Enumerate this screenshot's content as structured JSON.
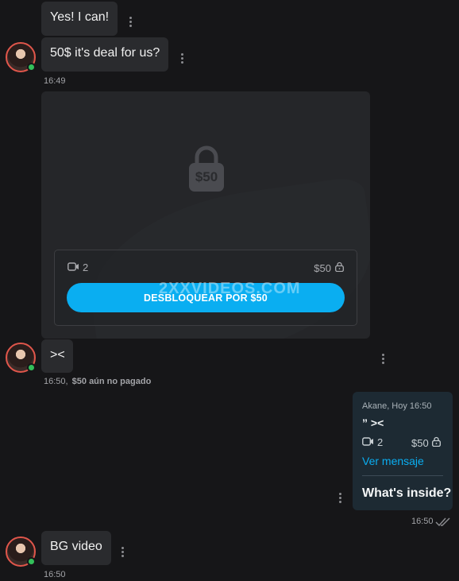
{
  "messages": {
    "m1": {
      "text": "Yes! I can!"
    },
    "m2": {
      "text": "50$ it's deal for us?",
      "time": "16:49"
    },
    "locked_post": {
      "lock_price": "$50",
      "video_count": "2",
      "price": "$50",
      "unlock_label": "DESBLOQUEAR POR $50"
    },
    "m3": {
      "text": "><",
      "time": "16:50,",
      "status": "$50 aún no pagado"
    },
    "sent": {
      "header": "Akane, Hoy 16:50",
      "quote": "” ><",
      "video_count": "2",
      "price": "$50",
      "link_label": "Ver mensaje",
      "text": "What's inside?",
      "time": "16:50"
    },
    "m4": {
      "text": "BG video",
      "time": "16:50"
    }
  },
  "watermark": "2XXVIDEOS.COM",
  "colors": {
    "background": "#161618",
    "bubble": "#2a2b2e",
    "accent": "#0aaef1",
    "sent_bubble": "#1d2a33",
    "online": "#33c05a",
    "avatar_ring": "#e0564b"
  },
  "icons": [
    "more-vertical-icon",
    "lock-icon",
    "video-camera-icon",
    "double-check-icon"
  ]
}
